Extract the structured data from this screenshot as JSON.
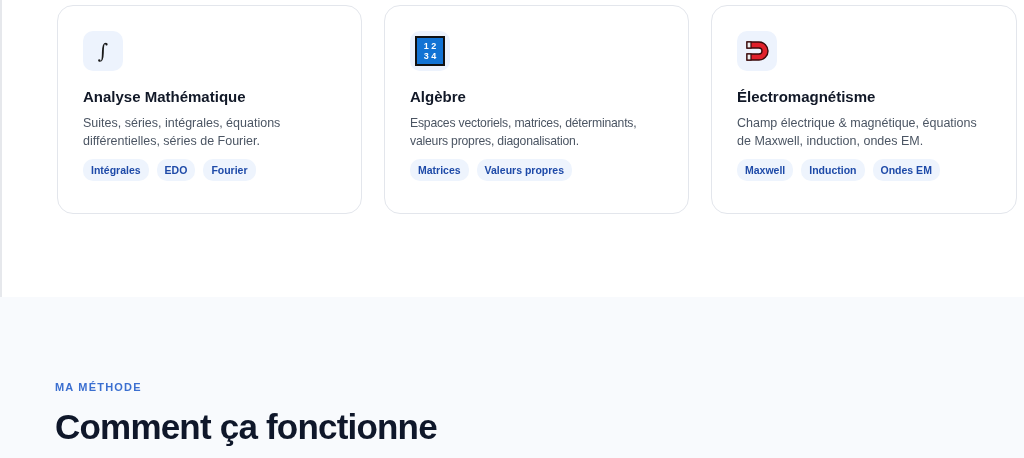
{
  "cards": [
    {
      "icon": {
        "kind": "glyph",
        "glyph": "∫"
      },
      "title": "Analyse Mathématique",
      "description": "Suites, séries, intégrales, équations différentielles, séries de Fourier.",
      "tags": [
        "Intégrales",
        "EDO",
        "Fourier"
      ]
    },
    {
      "icon": {
        "kind": "matrix",
        "lines": [
          "1 2",
          "3 4"
        ]
      },
      "title": "Algèbre",
      "description": "Espaces vectoriels, matrices, déterminants, valeurs propres, diagonalisation.",
      "tags": [
        "Matrices",
        "Valeurs propres"
      ]
    },
    {
      "icon": {
        "kind": "magnet"
      },
      "title": "Électromagnétisme",
      "description": "Champ électrique & magnétique, équations de Maxwell, induction, ondes EM.",
      "tags": [
        "Maxwell",
        "Induction",
        "Ondes EM"
      ]
    }
  ],
  "method_section": {
    "eyebrow": "MA MÉTHODE",
    "heading": "Comment ça fonctionne"
  }
}
